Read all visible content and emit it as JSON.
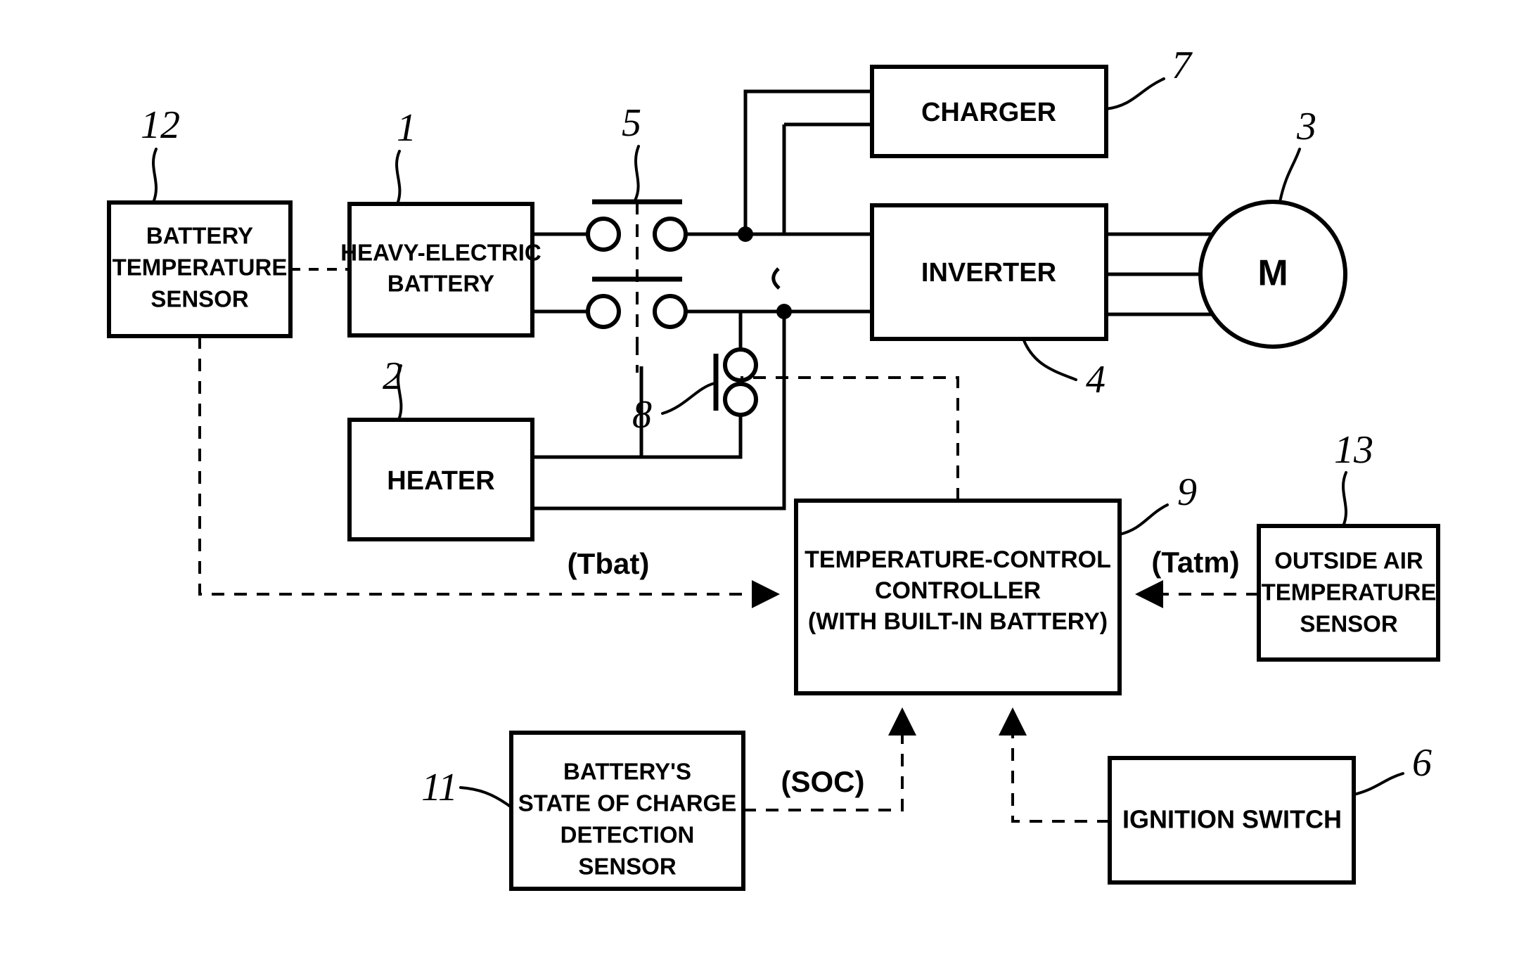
{
  "diagram": {
    "title": "Battery temperature-control system block diagram",
    "background_color": "#ffffff",
    "line_color": "#000000",
    "blocks": [
      {
        "id": "b12",
        "ref": "12",
        "lines": [
          "BATTERY",
          "TEMPERATURE",
          "SENSOR"
        ]
      },
      {
        "id": "b1",
        "ref": "1",
        "lines": [
          "HEAVY-ELECTRIC",
          "BATTERY"
        ]
      },
      {
        "id": "b2",
        "ref": "2",
        "lines": [
          "HEATER"
        ]
      },
      {
        "id": "b7",
        "ref": "7",
        "lines": [
          "CHARGER"
        ]
      },
      {
        "id": "b4",
        "ref": "4",
        "lines": [
          "INVERTER"
        ]
      },
      {
        "id": "b3",
        "ref": "3",
        "lines": [
          "M"
        ]
      },
      {
        "id": "b9",
        "ref": "9",
        "lines": [
          "TEMPERATURE-CONTROL",
          "CONTROLLER",
          "(WITH BUILT-IN BATTERY)"
        ]
      },
      {
        "id": "b13",
        "ref": "13",
        "lines": [
          "OUTSIDE AIR",
          "TEMPERATURE",
          "SENSOR"
        ]
      },
      {
        "id": "b11",
        "ref": "11",
        "lines": [
          "BATTERY'S",
          "STATE OF CHARGE",
          "DETECTION",
          "SENSOR"
        ]
      },
      {
        "id": "b6",
        "ref": "6",
        "lines": [
          "IGNITION SWITCH"
        ]
      }
    ],
    "switches": [
      {
        "id": "s5",
        "ref": "5",
        "kind": "double-pole-relay"
      },
      {
        "id": "s8",
        "ref": "8",
        "kind": "single-pole-relay"
      }
    ],
    "signals": [
      {
        "id": "tbat",
        "label": "(Tbat)"
      },
      {
        "id": "tatm",
        "label": "(Tatm)"
      },
      {
        "id": "soc",
        "label": "(SOC)"
      }
    ],
    "reference_numerals": [
      "12",
      "1",
      "5",
      "7",
      "3",
      "2",
      "8",
      "4",
      "9",
      "13",
      "11",
      "6"
    ]
  }
}
